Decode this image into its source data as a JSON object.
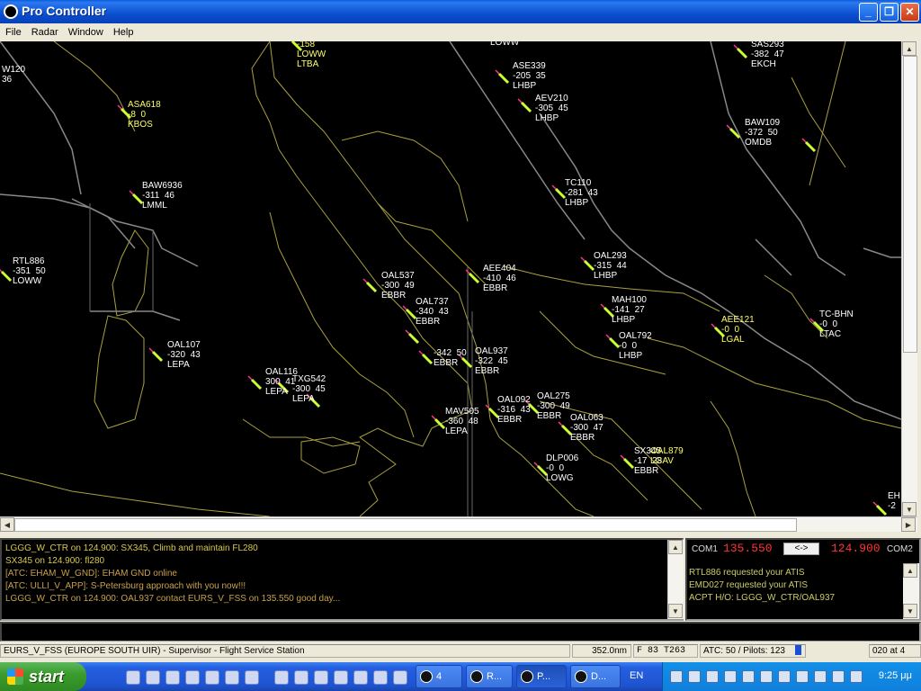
{
  "window": {
    "title": "Pro Controller"
  },
  "menu": [
    "File",
    "Radar",
    "Window",
    "Help"
  ],
  "radar": {
    "tags": [
      {
        "id": "t1",
        "lines": [
          "-158",
          "LOWW",
          "LTBA"
        ],
        "color": "yellow"
      },
      {
        "id": "t2",
        "lines": [
          "LOWW"
        ]
      },
      {
        "id": "t3",
        "lines": [
          "SAS293",
          "-382  47",
          "EKCH"
        ]
      },
      {
        "id": "t4",
        "lines": [
          "W120",
          "36"
        ]
      },
      {
        "id": "t5",
        "lines": [
          "ASE339",
          "-205  35",
          "LHBP"
        ]
      },
      {
        "id": "t6",
        "lines": [
          "AEV210",
          "-305  45",
          "LHBP"
        ]
      },
      {
        "id": "t7",
        "lines": [
          "ASA618",
          "-8  0",
          "KBOS"
        ],
        "color": "yellow"
      },
      {
        "id": "t8",
        "lines": [
          "BAW109",
          "-372  50",
          "OMDB"
        ]
      },
      {
        "id": "t9",
        "lines": [
          "BAW6936",
          "-311  46",
          "LMML"
        ]
      },
      {
        "id": "t10",
        "lines": [
          "TC110",
          "-281  43",
          "LHBP"
        ]
      },
      {
        "id": "t11",
        "lines": [
          "RTL886",
          "-351  50",
          "LOWW"
        ]
      },
      {
        "id": "t12",
        "lines": [
          "OAL293",
          "-315  44",
          "LHBP"
        ]
      },
      {
        "id": "t13",
        "lines": [
          "AEE404",
          "-410  46",
          "EBBR"
        ]
      },
      {
        "id": "t14",
        "lines": [
          "OAL537",
          "-300  49",
          "EBBR"
        ]
      },
      {
        "id": "t15",
        "lines": [
          "MAH100",
          "-141  27",
          "LHBP"
        ]
      },
      {
        "id": "t16",
        "lines": [
          "OAL737",
          "-340  43",
          "EBBR"
        ]
      },
      {
        "id": "t17",
        "lines": [
          "AEE121",
          "-0  0",
          "LGAL"
        ],
        "color": "yellow"
      },
      {
        "id": "t18",
        "lines": [
          "TC-BHN",
          "-0  0",
          "LTAC"
        ]
      },
      {
        "id": "t19",
        "lines": [
          "OAL792",
          "-0  0",
          "LHBP"
        ]
      },
      {
        "id": "t20",
        "lines": [
          "OAL107",
          "-320  43",
          "LEPA"
        ]
      },
      {
        "id": "t21",
        "lines": [
          "OAL937",
          "-322  45",
          "EBBR"
        ]
      },
      {
        "id": "t22",
        "lines": [
          "-342  50",
          "EBBR"
        ]
      },
      {
        "id": "t23",
        "lines": [
          "OAL116",
          "300  41",
          "LEPA"
        ]
      },
      {
        "id": "t24",
        "lines": [
          "TXG542",
          "-300  45",
          "LEPA"
        ]
      },
      {
        "id": "t25",
        "lines": [
          "OAL275",
          "-300  49",
          "EBBR"
        ]
      },
      {
        "id": "t26",
        "lines": [
          "OAL092",
          "-316  43",
          "EBBR"
        ]
      },
      {
        "id": "t27",
        "lines": [
          "MAV505",
          "-360  48",
          "LEPA"
        ]
      },
      {
        "id": "t28",
        "lines": [
          "OAL063",
          "-300  47",
          "EBBR"
        ]
      },
      {
        "id": "t29",
        "lines": [
          "DLP006",
          "-0  0",
          "LOWG"
        ]
      },
      {
        "id": "t30",
        "lines": [
          "SX345",
          "-17  28",
          "EBBR"
        ]
      },
      {
        "id": "t31",
        "lines": [
          "OAL879",
          "LGAV"
        ],
        "color": "yellow"
      },
      {
        "id": "t32",
        "lines": [
          "EH",
          "-2"
        ]
      }
    ]
  },
  "messages": [
    {
      "text": "LGGG_W_CTR on 124.900: SX345, Climb and maintain FL280",
      "color": "#d8c84a"
    },
    {
      "text": "SX345 on 124.900: fl280",
      "color": "#d8c84a"
    },
    {
      "text": "[ATC: EHAM_W_GND]: EHAM GND online",
      "color": "#c8a04a"
    },
    {
      "text": "[ATC: ULLI_V_APP]: S-Petersburg approach with you now!!!",
      "color": "#c8a04a"
    },
    {
      "text": "LGGG_W_CTR on 124.900: OAL937 contact EURS_V_FSS on 135.550 good day...",
      "color": "#c8a04a"
    }
  ],
  "com": {
    "com1_label": "COM1",
    "com1_freq": "135.550",
    "swap_label": "<->",
    "com2_freq": "124.900",
    "com2_label": "COM2",
    "log": [
      "RTL886 requested your ATIS",
      "EMD027 requested your ATIS",
      "ACPT H/O: LGGG_W_CTR/OAL937"
    ]
  },
  "status": {
    "station": "EURS_V_FSS (EUROPE SOUTH UIR) - Supervisor - Flight Service Station",
    "distance": "352.0nm",
    "alt": "F 83  T263",
    "counts": "ATC: 50 / Pilots: 123",
    "heading": "020 at 4"
  },
  "taskbar": {
    "start": "start",
    "tasks": [
      {
        "label": "4",
        "name": "task-group"
      },
      {
        "label": "R...",
        "name": "task-r"
      },
      {
        "label": "P...",
        "name": "task-pro-controller"
      },
      {
        "label": "D...",
        "name": "task-d"
      }
    ],
    "lang": "EN",
    "clock": "9:25 μμ"
  }
}
